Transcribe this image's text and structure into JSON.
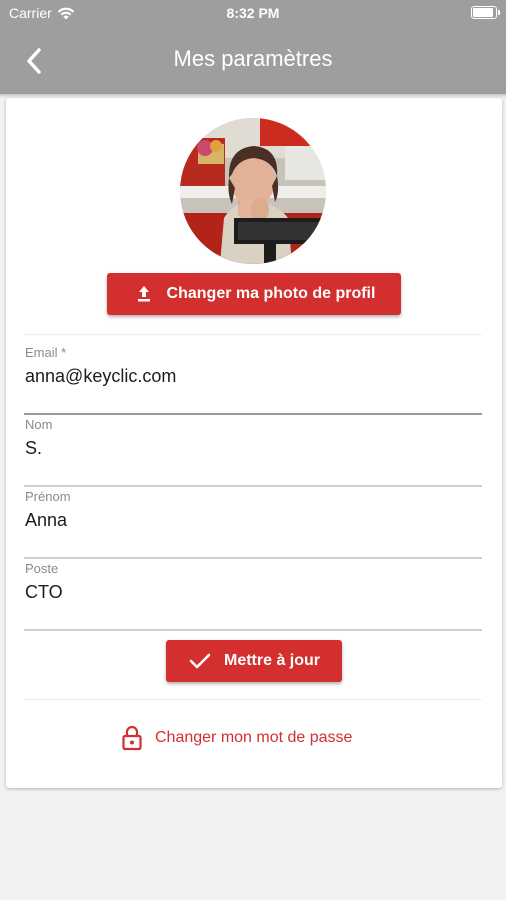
{
  "status_bar": {
    "carrier": "Carrier",
    "time": "8:32 PM",
    "battery_level": 0.9
  },
  "header": {
    "title": "Mes paramètres"
  },
  "profile": {
    "change_photo_label": "Changer ma photo de profil"
  },
  "form": {
    "email": {
      "label": "Email *",
      "value": "anna@keyclic.com"
    },
    "last_name": {
      "label": "Nom",
      "value": "S."
    },
    "first_name": {
      "label": "Prénom",
      "value": "Anna"
    },
    "position": {
      "label": "Poste",
      "value": "CTO"
    },
    "update_label": "Mettre à jour"
  },
  "change_password_label": "Changer mon mot de passe",
  "colors": {
    "accent": "#d32f2f",
    "header_bg": "#9e9e9e",
    "page_bg": "#f2f2f2"
  },
  "icons": [
    "wifi-icon",
    "battery-icon",
    "back-chevron-icon",
    "upload-icon",
    "checkmark-icon",
    "lock-icon"
  ]
}
